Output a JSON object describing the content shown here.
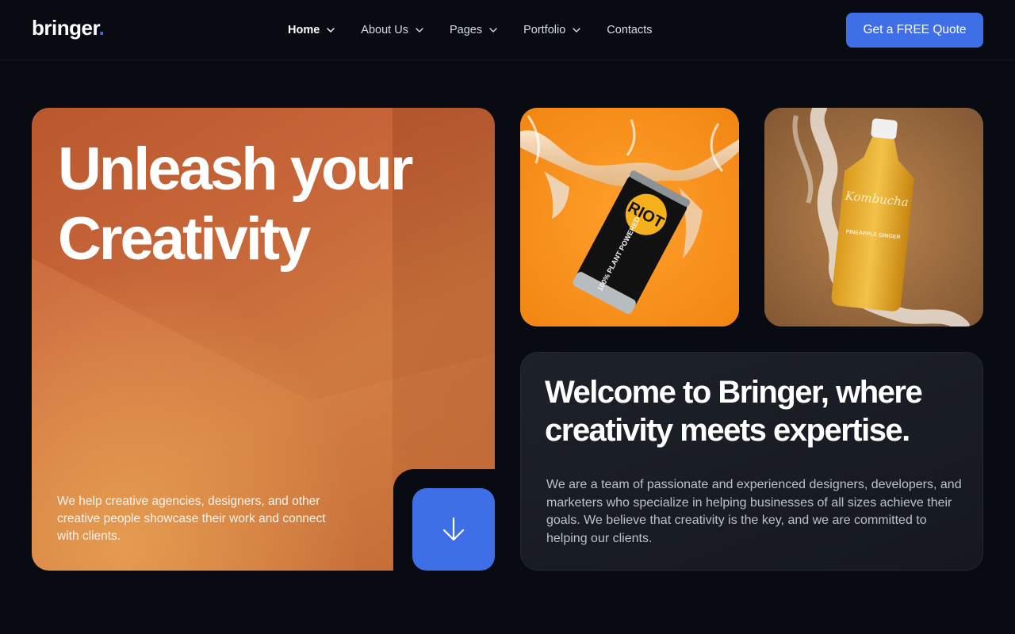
{
  "brand": {
    "name": "bringer",
    "dot": ".",
    "accent": "#3f6fe6"
  },
  "nav": {
    "items": [
      {
        "label": "Home",
        "active": true,
        "dropdown": true
      },
      {
        "label": "About Us",
        "active": false,
        "dropdown": true
      },
      {
        "label": "Pages",
        "active": false,
        "dropdown": true
      },
      {
        "label": "Portfolio",
        "active": false,
        "dropdown": true
      },
      {
        "label": "Contacts",
        "active": false,
        "dropdown": false
      }
    ],
    "icon": "chevron-down-icon"
  },
  "cta": {
    "label": "Get a FREE Quote"
  },
  "hero": {
    "title_line1": "Unleash your",
    "title_line2": "Creativity",
    "description": "We help creative agencies, designers, and other creative people showcase their work and connect with clients.",
    "scroll_icon": "arrow-down-icon"
  },
  "gallery": {
    "can": {
      "text_top": "RIOT",
      "text_side": "100% PLANT POWERED"
    },
    "bottle": {
      "brand": "Kombucha",
      "flavor": "PINEAPPLE GINGER"
    }
  },
  "welcome": {
    "title": "Welcome to Bringer, where creativity meets expertise.",
    "text": "We are a team of passionate and experienced designers, developers, and marketers who specialize in helping businesses of all sizes achieve their goals. We believe that creativity is the key, and we are committed to helping our clients."
  },
  "colors": {
    "background": "#080b12",
    "hero_orange": "#c7673a",
    "can_tile": "#f7931d",
    "card": "#1d2129"
  }
}
